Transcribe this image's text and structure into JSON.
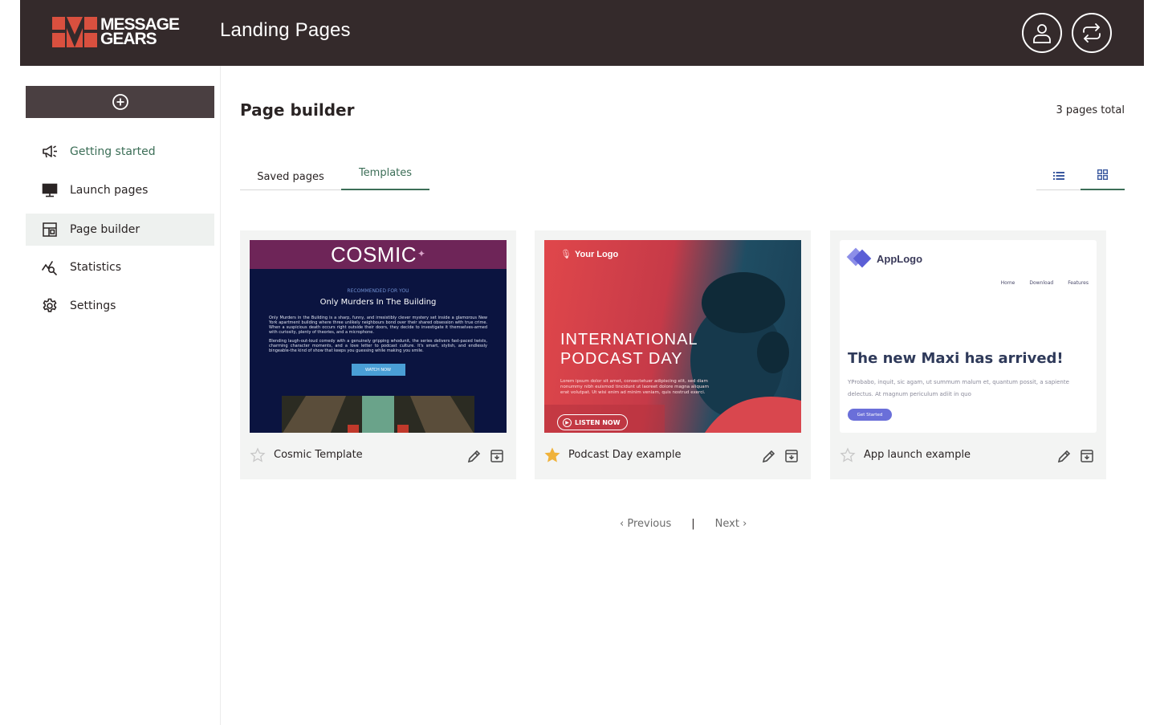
{
  "header": {
    "brand_line1": "MESSAGE",
    "brand_line2": "GEARS",
    "title": "Landing Pages",
    "user_icon": "user-icon",
    "switch_icon": "switch-icon"
  },
  "sidebar": {
    "create_icon": "plus-circle-icon",
    "items": [
      {
        "label": "Getting started",
        "icon": "megaphone-icon"
      },
      {
        "label": "Launch pages",
        "icon": "monitor-icon"
      },
      {
        "label": "Page builder",
        "icon": "page-builder-icon"
      },
      {
        "label": "Statistics",
        "icon": "statistics-icon"
      },
      {
        "label": "Settings",
        "icon": "gear-icon"
      }
    ]
  },
  "main": {
    "title": "Page builder",
    "total": "3 pages total",
    "tabs": [
      {
        "label": "Saved pages"
      },
      {
        "label": "Templates"
      }
    ],
    "view_icons": [
      "list-view-icon",
      "grid-view-icon"
    ]
  },
  "cards": [
    {
      "name": "Cosmic Template",
      "favorite": false,
      "thumb": {
        "brand": "COSMIC",
        "eyebrow": "RECOMMENDED FOR YOU",
        "heading": "Only Murders In The Building",
        "body1": "Only Murders in the Building is a sharp, funny, and irresistibly clever mystery set inside a glamorous New York apartment building where three unlikely neighbours bond over their shared obsession with true crime. When a suspicious death occurs right outside their doors, they decide to investigate it themselves-armed with curiosity, plenty of theories, and a microphone.",
        "body2": "Blending laugh-out-loud comedy with a genuinely gripping whodunit, the series delivers fast-paced twists, charming character moments, and a love letter to podcast culture. It's smart, stylish, and endlessly bingeable-the kind of show that keeps you guessing while making you smile.",
        "cta": "WATCH NOW"
      }
    },
    {
      "name": "Podcast Day example",
      "favorite": true,
      "thumb": {
        "logo": "Your Logo",
        "heading1": "INTERNATIONAL",
        "heading2": "PODCAST DAY",
        "body": "Lorem ipsum dolor sit amet, consectetuer adipiscing elit, sed diam nonummy nibh euismod tincidunt ut laoreet dolore magna aliquam erat volutpat. Ut wisi enim ad minim veniam, quis nostrud exerci.",
        "cta": "LISTEN NOW"
      }
    },
    {
      "name": "App launch example",
      "favorite": false,
      "thumb": {
        "logo": "AppLogo",
        "nav": [
          "Home",
          "Download",
          "Features"
        ],
        "heading": "The new Maxi has arrived!",
        "body": "YProbabo, inquit, sic agam, ut summum malum et, quantum possit, a sapiente delectus. At magnum periculum adiit in quo",
        "cta": "Get Started"
      }
    }
  ],
  "pagination": {
    "previous": "‹ Previous",
    "separator": "|",
    "next": "Next ›"
  },
  "colors": {
    "topbar": "#342a2b",
    "accent": "#3c6e57",
    "star": "#f0b23a",
    "brand_red": "#d9503f"
  }
}
